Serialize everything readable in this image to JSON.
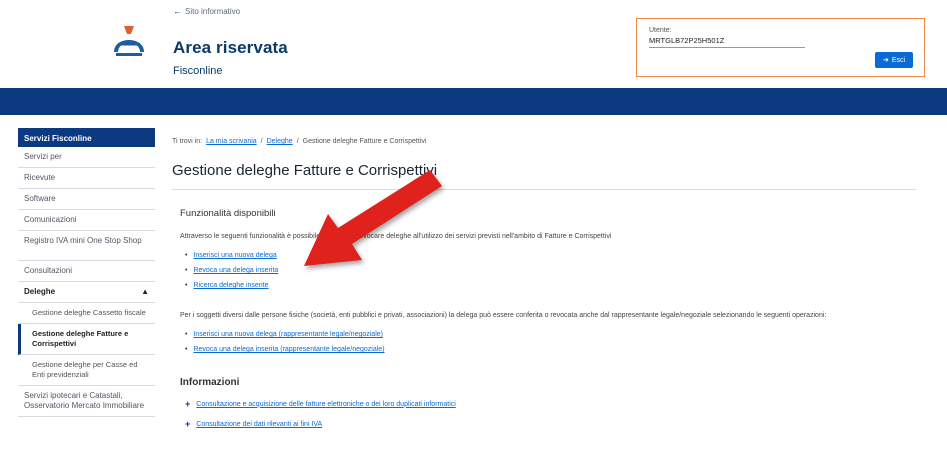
{
  "header": {
    "back_label": "Sito informativo",
    "title": "Area riservata",
    "subtitle": "Fisconline",
    "user_label": "Utente:",
    "user_code": "MRTGLB72P25H501Z",
    "exit_label": "Esci",
    "icons": {
      "back": "arrow-left-icon",
      "exit": "logout-icon",
      "logo": "agenzia-entrate-logo"
    }
  },
  "sidebar": {
    "header": "Servizi Fisconline",
    "items_top": [
      "Servizi per",
      "Ricevute",
      "Software",
      "Comunicazioni",
      "Registro IVA mini One Stop Shop",
      "Consultazioni"
    ],
    "group_label": "Deleghe",
    "group_icon": "chevron-up-icon",
    "sub_items": [
      "Gestione deleghe Cassetto fiscale",
      "Gestione deleghe Fatture e Corrispettivi",
      "Gestione deleghe per Casse ed Enti previdenziali"
    ],
    "active_sub_index": 1,
    "items_bottom": [
      "Servizi ipotecari e Catastali, Osservatorio Mercato Immobiliare"
    ]
  },
  "main": {
    "breadcrumb": {
      "prefix": "Ti trovi in:",
      "link1": "La mia scrivania",
      "sep": "/",
      "link2": "Deleghe",
      "current": "Gestione deleghe Fatture e Corrispettivi"
    },
    "title": "Gestione deleghe Fatture e Corrispettivi",
    "section_title": "Funzionalità disponibili",
    "intro": "Attraverso le seguenti funzionalità è possibile conferire o revocare deleghe all'utilizzo dei servizi previsti nell'ambito di Fatture e Corrispettivi",
    "links": [
      "Inserisci una nuova delega",
      "Revoca una delega inserita",
      "Ricerca deleghe inserite"
    ],
    "para2": "Per i soggetti diversi dalle persone fisiche (società, enti pubblici e privati, associazioni) la delega può essere conferita o revocata anche dal rappresentante legale/negoziale selezionando le seguenti operazioni:",
    "links2": [
      "Inserisci una nuova delega (rappresentante legale/negoziale)",
      "Revoca una delega inserita (rappresentante legale/negoziale)"
    ],
    "info_title": "Informazioni",
    "info_links": [
      "Consultazione e acquisizione delle fatture elettroniche o dei loro duplicati informatici",
      "Consultazione dei dati rilevanti ai fini IVA"
    ]
  },
  "colors": {
    "brand_blue": "#0b3a80",
    "link_blue": "#0a6ad6",
    "accent_orange": "#f08a4b",
    "arrow_red": "#e0201f"
  }
}
